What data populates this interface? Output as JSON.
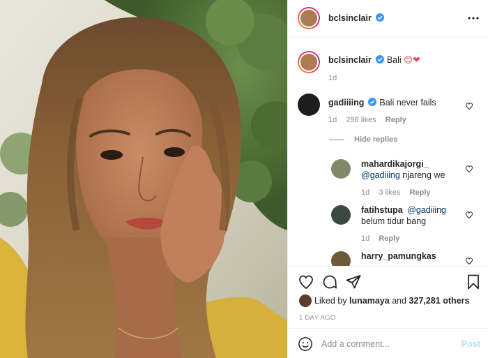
{
  "post": {
    "username": "bclsinclair",
    "caption": "Bali",
    "caption_emojis": "😊❤",
    "time_ago": "1d"
  },
  "comments": [
    {
      "username": "gadiiiing",
      "text": "Bali never fails",
      "time": "1d",
      "likes": "298 likes",
      "reply": "Reply"
    }
  ],
  "hide_replies": "Hide replies",
  "replies": [
    {
      "username": "mahardikajorgi_",
      "mention": "@gadiiing",
      "text": "njareng we",
      "time": "1d",
      "likes": "3 likes",
      "reply": "Reply"
    },
    {
      "username": "fatihstupa",
      "mention": "@gadiiing",
      "text": "belum tidur bang",
      "time": "1d",
      "reply": "Reply"
    },
    {
      "username": "harry_pamungkas"
    }
  ],
  "liked_by": {
    "prefix": "Liked by",
    "user": "lunamaya",
    "connector": "and",
    "others": "327,281 others"
  },
  "date": "1 DAY AGO",
  "add_comment": {
    "placeholder": "Add a comment...",
    "post_label": "Post"
  },
  "colors": {
    "verified": "#3897f0",
    "heart": "#ed4956",
    "link": "#00376b",
    "post_disabled": "#b2dffc"
  },
  "icons": [
    "more-icon",
    "verified-icon",
    "heart-icon",
    "comment-icon",
    "share-icon",
    "bookmark-icon",
    "emoji-icon"
  ]
}
